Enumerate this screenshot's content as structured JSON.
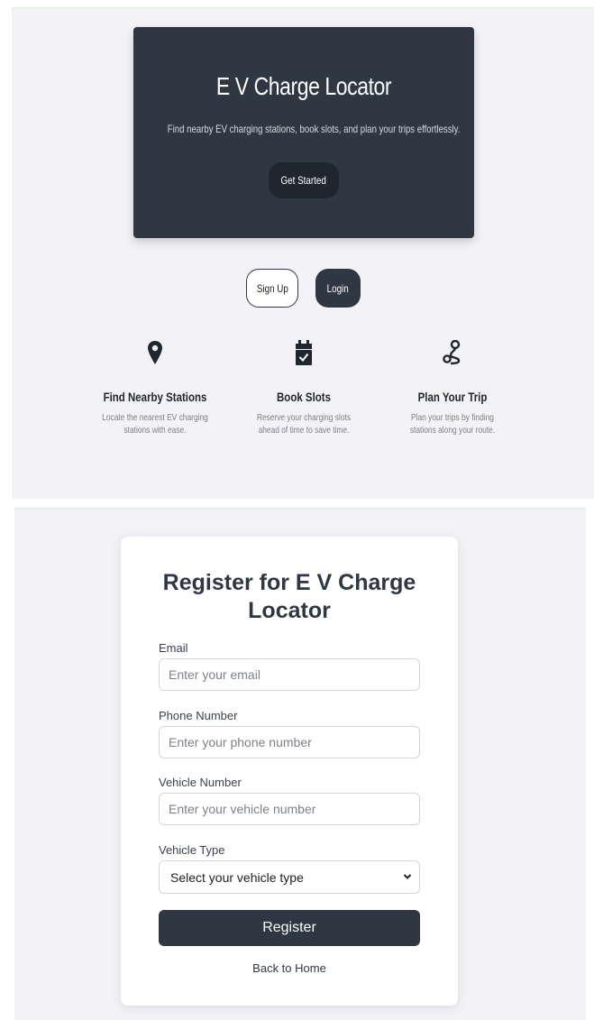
{
  "hero": {
    "title": "E V Charge Locator",
    "subtitle": "Find nearby EV charging stations, book slots, and plan your trips effortlessly.",
    "cta_label": "Get Started"
  },
  "auth": {
    "signup_label": "Sign Up",
    "login_label": "Login"
  },
  "features": [
    {
      "icon": "map-pin-icon",
      "title": "Find Nearby Stations",
      "description": "Locate the nearest EV charging stations with ease."
    },
    {
      "icon": "calendar-check-icon",
      "title": "Book Slots",
      "description": "Reserve your charging slots ahead of time to save time."
    },
    {
      "icon": "route-icon",
      "title": "Plan Your Trip",
      "description": "Plan your trips by finding stations along your route."
    }
  ],
  "register": {
    "title": "Register for E V Charge Locator",
    "email_label": "Email",
    "email_placeholder": "Enter your email",
    "phone_label": "Phone Number",
    "phone_placeholder": "Enter your phone number",
    "vehicle_number_label": "Vehicle Number",
    "vehicle_number_placeholder": "Enter your vehicle number",
    "vehicle_type_label": "Vehicle Type",
    "vehicle_type_selected": "Select your vehicle type",
    "submit_label": "Register",
    "back_link": "Back to Home"
  },
  "colors": {
    "primary_dark": "#2f3742",
    "background": "#f3f2f7",
    "accent_border": "#e4f1e6"
  }
}
